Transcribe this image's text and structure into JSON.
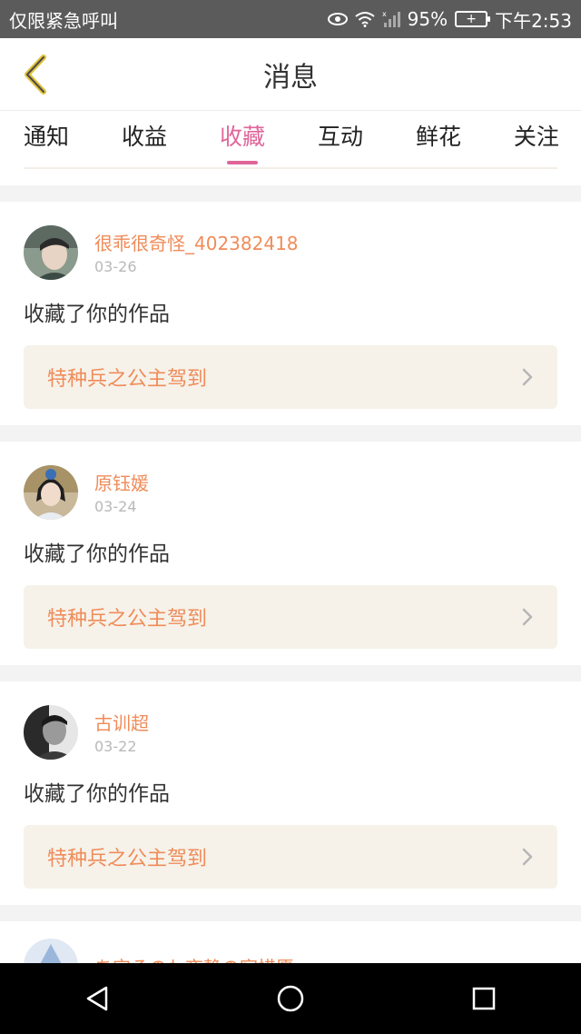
{
  "status_bar": {
    "left_text": "仅限紧急呼叫",
    "battery_percent": "95%",
    "time": "下午2:53",
    "icons": [
      "eye-icon",
      "wifi-icon",
      "signal-icon",
      "battery-icon"
    ]
  },
  "header": {
    "title": "消息",
    "back_icon": "back-chevron-icon",
    "accent_color": "#e0c23a"
  },
  "tabs": [
    {
      "label": "通知",
      "active": false
    },
    {
      "label": "收益",
      "active": false
    },
    {
      "label": "收藏",
      "active": true
    },
    {
      "label": "互动",
      "active": false
    },
    {
      "label": "鲜花",
      "active": false
    },
    {
      "label": "关注",
      "active": false
    }
  ],
  "colors": {
    "active_tab": "#e0669a",
    "username": "#f08c59",
    "work_title": "#f08c59",
    "work_box_bg": "#f6f2ea"
  },
  "notifications": [
    {
      "user": "很乖很奇怪_402382418",
      "date": "03-26",
      "action": "收藏了你的作品",
      "work": "特种兵之公主驾到"
    },
    {
      "user": "原钰媛",
      "date": "03-24",
      "action": "收藏了你的作品",
      "work": "特种兵之公主驾到"
    },
    {
      "user": "古训超",
      "date": "03-22",
      "action": "收藏了你的作品",
      "work": "特种兵之公主驾到"
    }
  ],
  "partial_user": "あ宝そのわ夜静の寂惜愿",
  "nav_bar": [
    "back-triangle-icon",
    "home-circle-icon",
    "recents-square-icon"
  ]
}
